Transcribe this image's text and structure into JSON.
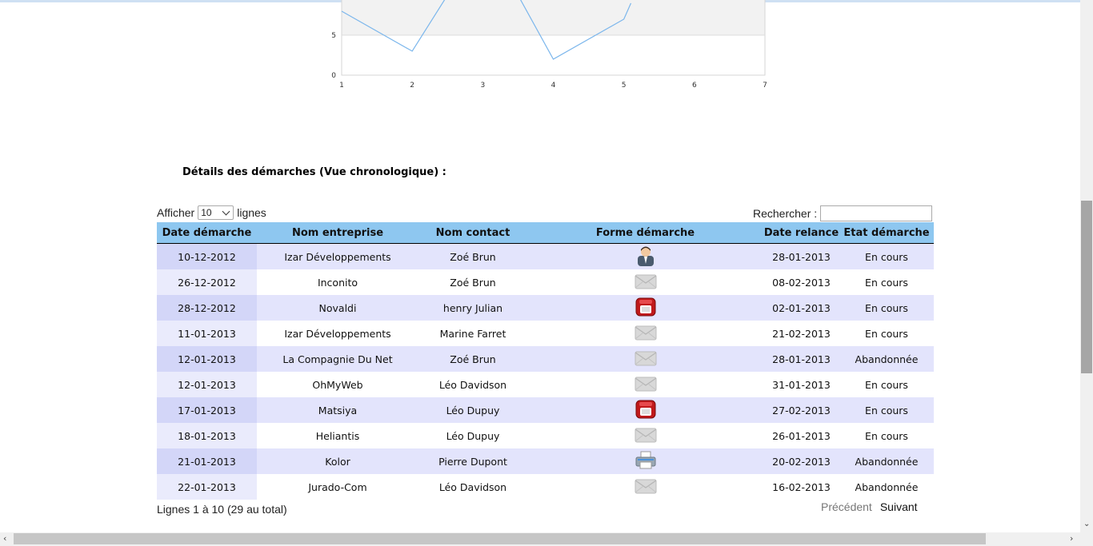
{
  "chart_data": {
    "type": "line",
    "x": [
      1,
      2,
      3,
      4,
      5,
      6,
      7
    ],
    "x_ticks": [
      "1",
      "2",
      "3",
      "4",
      "5",
      "6",
      "7"
    ],
    "y_ticks": [
      "0",
      "5"
    ],
    "series": [
      {
        "points": [
          [
            1,
            8
          ],
          [
            2,
            3
          ],
          [
            2.5,
            10
          ],
          [
            3.5,
            10
          ],
          [
            4,
            2
          ],
          [
            5,
            7
          ],
          [
            5.1,
            9
          ]
        ],
        "color": "#7bb6ec"
      }
    ],
    "ylim": [
      0,
      10
    ],
    "xlim": [
      1,
      7
    ],
    "grid": true
  },
  "section": {
    "title": "Détails des démarches (Vue chronologique) :"
  },
  "length_control": {
    "prefix": "Afficher",
    "value": "10",
    "suffix": "lignes"
  },
  "search": {
    "label": "Rechercher :",
    "value": ""
  },
  "table": {
    "headers": [
      "Date démarche",
      "Nom entreprise",
      "Nom contact",
      "Forme démarche",
      "Date relance",
      "Etat démarche"
    ],
    "rows": [
      {
        "date": "10-12-2012",
        "entreprise": "Izar Développements",
        "contact": "Zoé Brun",
        "forme": "person-icon",
        "relance": "28-01-2013",
        "etat": "En cours"
      },
      {
        "date": "26-12-2012",
        "entreprise": "Inconito",
        "contact": "Zoé Brun",
        "forme": "envelope-icon",
        "relance": "08-02-2013",
        "etat": "En cours"
      },
      {
        "date": "28-12-2012",
        "entreprise": "Novaldi",
        "contact": "henry Julian",
        "forme": "phone-icon",
        "relance": "02-01-2013",
        "etat": "En cours"
      },
      {
        "date": "11-01-2013",
        "entreprise": "Izar Développements",
        "contact": "Marine Farret",
        "forme": "envelope-icon",
        "relance": "21-02-2013",
        "etat": "En cours"
      },
      {
        "date": "12-01-2013",
        "entreprise": "La Compagnie Du Net",
        "contact": "Zoé Brun",
        "forme": "envelope-icon",
        "relance": "28-01-2013",
        "etat": "Abandonnée"
      },
      {
        "date": "12-01-2013",
        "entreprise": "OhMyWeb",
        "contact": "Léo Davidson",
        "forme": "envelope-icon",
        "relance": "31-01-2013",
        "etat": "En cours"
      },
      {
        "date": "17-01-2013",
        "entreprise": "Matsiya",
        "contact": "Léo Dupuy",
        "forme": "phone-icon",
        "relance": "27-02-2013",
        "etat": "En cours"
      },
      {
        "date": "18-01-2013",
        "entreprise": "Heliantis",
        "contact": "Léo Dupuy",
        "forme": "envelope-icon",
        "relance": "26-01-2013",
        "etat": "En cours"
      },
      {
        "date": "21-01-2013",
        "entreprise": "Kolor",
        "contact": "Pierre Dupont",
        "forme": "printer-icon",
        "relance": "20-02-2013",
        "etat": "Abandonnée"
      },
      {
        "date": "22-01-2013",
        "entreprise": "Jurado-Com",
        "contact": "Léo Davidson",
        "forme": "envelope-icon",
        "relance": "16-02-2013",
        "etat": "Abandonnée"
      }
    ]
  },
  "footer": {
    "info": "Lignes 1 à 10 (29 au total)",
    "prev": "Précédent",
    "next": "Suivant"
  },
  "colors": {
    "header_bg": "#8ec7f0",
    "row_odd": "#e3e4fc",
    "row_even": "#ffffff",
    "line": "#7bb6ec"
  }
}
